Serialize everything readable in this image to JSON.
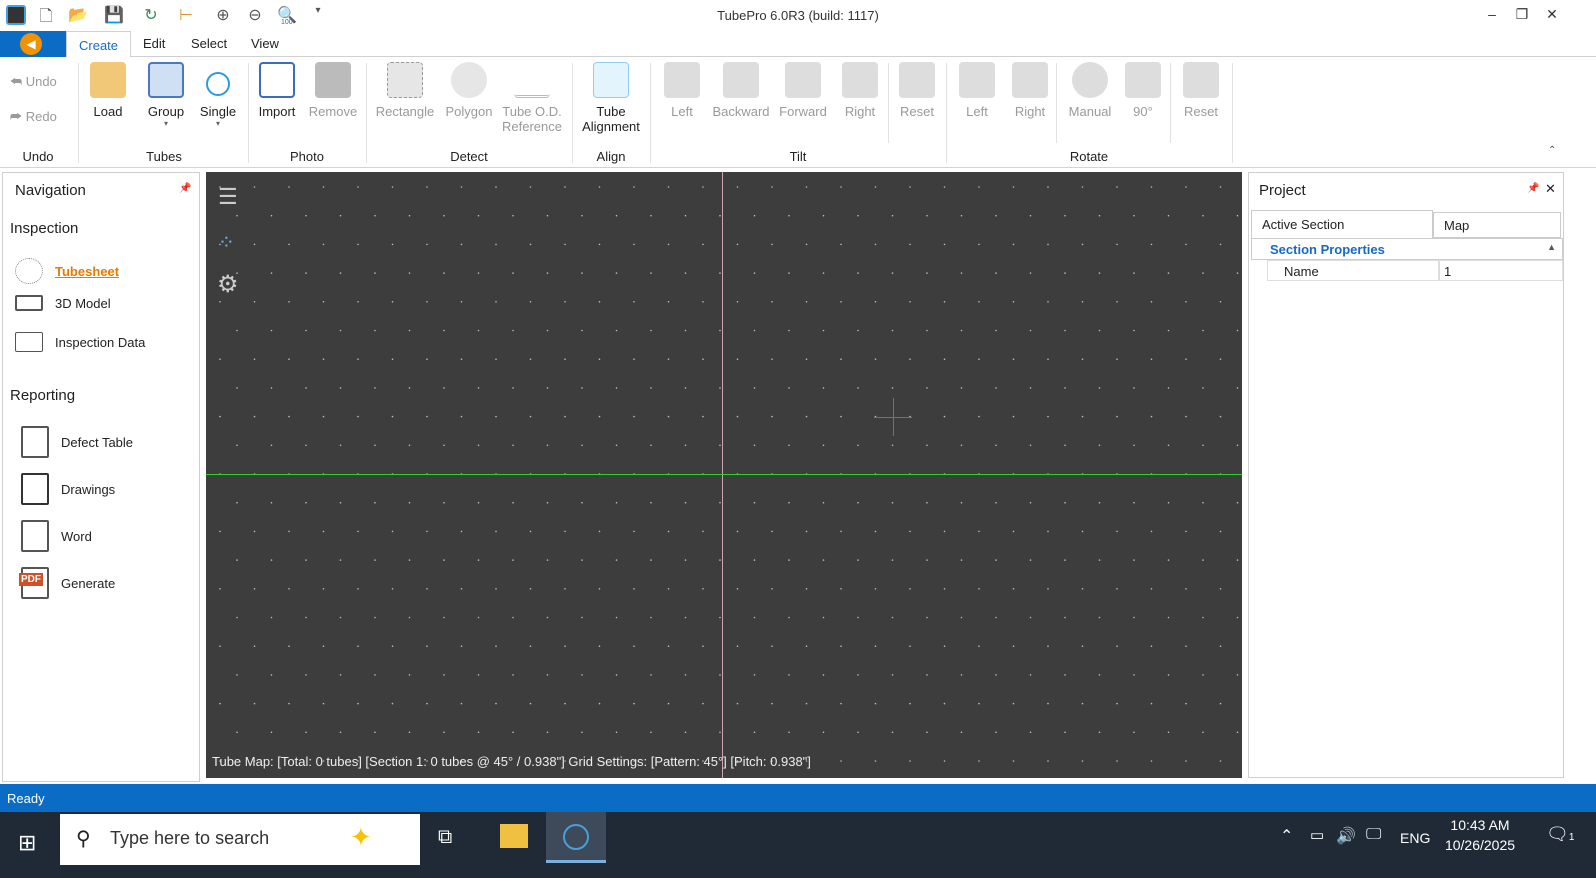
{
  "app": {
    "title": "TubePro 6.0R3 (build: 1117)"
  },
  "qat": {
    "zoom_100": "100"
  },
  "tabs": [
    "Create",
    "Edit",
    "Select",
    "View"
  ],
  "ribbon": {
    "undo": "Undo",
    "redo": "Redo",
    "load": "Load",
    "group": "Group",
    "single": "Single",
    "import": "Import",
    "remove": "Remove",
    "rectangle": "Rectangle",
    "polygon": "Polygon",
    "tube_od": "Tube O.D.",
    "reference": "Reference",
    "tube": "Tube",
    "alignment": "Alignment",
    "tilt_left": "Left",
    "tilt_backward": "Backward",
    "tilt_forward": "Forward",
    "tilt_right": "Right",
    "tilt_reset": "Reset",
    "rot_left": "Left",
    "rot_right": "Right",
    "rot_manual": "Manual",
    "rot_90": "90°",
    "rot_reset": "Reset",
    "groups": {
      "undo": "Undo",
      "tubes": "Tubes",
      "photo": "Photo",
      "detect": "Detect",
      "align": "Align",
      "tilt": "Tilt",
      "rotate": "Rotate"
    }
  },
  "navigation": {
    "title": "Navigation",
    "inspection": "Inspection",
    "tubesheet": "Tubesheet",
    "model": "3D Model",
    "inspection_data": "Inspection Data",
    "reporting": "Reporting",
    "defect_table": "Defect Table",
    "drawings": "Drawings",
    "word": "Word",
    "pdf_badge": "PDF",
    "generate": "Generate"
  },
  "canvas": {
    "status": "Tube Map: [Total: 0 tubes] [Section 1: 0 tubes @ 45° / 0.938\"] Grid Settings: [Pattern: 45°] [Pitch: 0.938\"]"
  },
  "project": {
    "title": "Project",
    "tabs": [
      "Active Section",
      "Map"
    ],
    "section_header": "Section Properties",
    "props": [
      {
        "name": "Name",
        "value": "1"
      }
    ]
  },
  "status": "Ready",
  "taskbar": {
    "search_placeholder": "Type here to search",
    "lang": "ENG",
    "time": "10:43 AM",
    "date": "10/26/2025",
    "notif_count": "1"
  }
}
